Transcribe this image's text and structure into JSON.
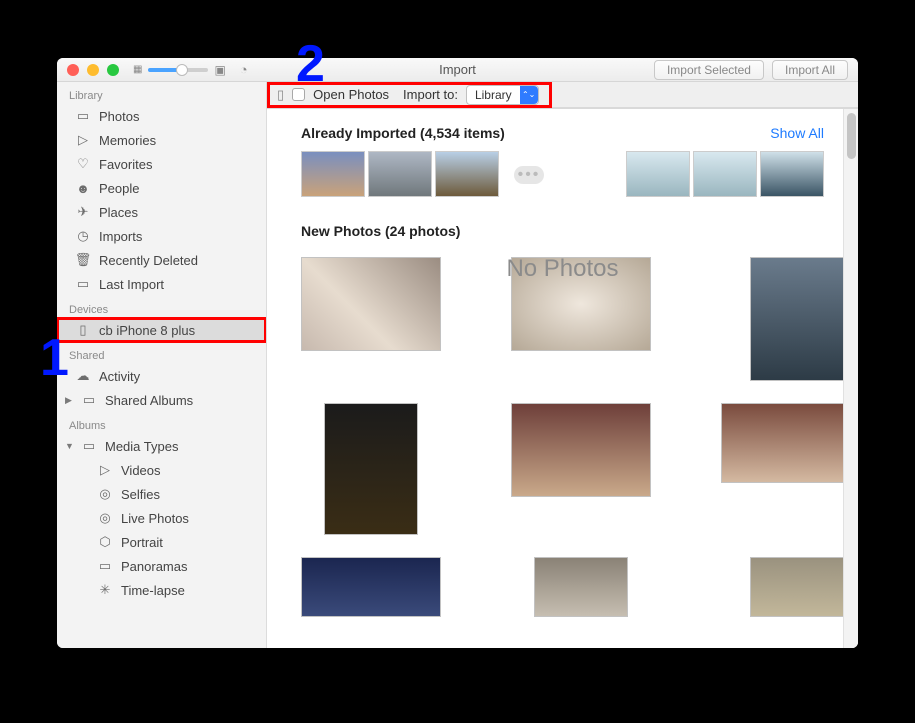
{
  "window": {
    "title": "Import"
  },
  "toolbar": {
    "import_selected": "Import Selected",
    "import_all": "Import All"
  },
  "sidebar": {
    "sections": {
      "library": "Library",
      "devices": "Devices",
      "shared": "Shared",
      "albums": "Albums"
    },
    "library_items": [
      "Photos",
      "Memories",
      "Favorites",
      "People",
      "Places",
      "Imports",
      "Recently Deleted",
      "Last Import"
    ],
    "device": "cb iPhone 8 plus",
    "shared_items": [
      "Activity",
      "Shared Albums"
    ],
    "albums_items": [
      "Media Types",
      "Videos",
      "Selfies",
      "Live Photos",
      "Portrait",
      "Panoramas",
      "Time-lapse"
    ]
  },
  "optionsbar": {
    "open_photos": "Open Photos",
    "import_to_label": "Import to:",
    "import_to_value": "Library"
  },
  "main": {
    "already_imported": "Already Imported (4,534 items)",
    "show_all": "Show All",
    "no_photos": "No Photos",
    "new_photos": "New Photos (24 photos)"
  },
  "annotations": {
    "one": "1",
    "two": "2"
  }
}
